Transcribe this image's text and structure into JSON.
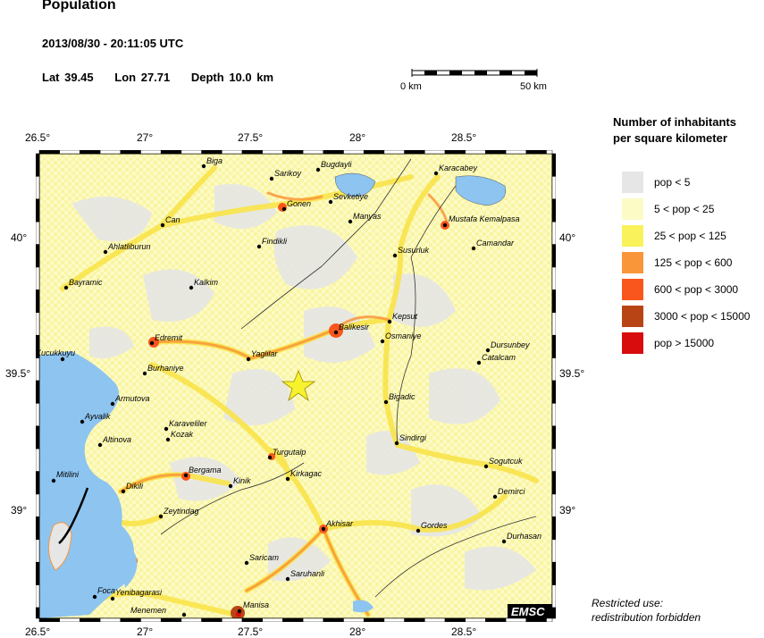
{
  "header": {
    "title": "Population",
    "datetime": "2013/08/30 - 20:11:05 UTC",
    "lat_label": "Lat 39.45",
    "lon_label": "Lon 27.71",
    "depth_label": "Depth 10.0 km"
  },
  "scale_bar": {
    "start_label": "0 km",
    "end_label": "50 km"
  },
  "axes": {
    "top_ticks": [
      "26.5°",
      "27°",
      "27.5°",
      "28°",
      "28.5°"
    ],
    "bottom_ticks": [
      "26.5°",
      "27°",
      "27.5°",
      "28°",
      "28.5°"
    ],
    "left_ticks": [
      "40°",
      "39.5°",
      "39°"
    ],
    "right_ticks": [
      "40°",
      "39.5°",
      "39°"
    ]
  },
  "legend": {
    "title_line1": "Number of inhabitants",
    "title_line2": "per square kilometer",
    "items": [
      {
        "label": "pop < 5",
        "color": "#e6e6e6"
      },
      {
        "label": "5 < pop < 25",
        "color": "#fcfbc6"
      },
      {
        "label": "25 < pop < 125",
        "color": "#f9f25a"
      },
      {
        "label": "125 < pop < 600",
        "color": "#f9963a"
      },
      {
        "label": "600 < pop < 3000",
        "color": "#f8561c"
      },
      {
        "label": "3000 < pop < 15000",
        "color": "#b84415"
      },
      {
        "label": "pop > 15000",
        "color": "#d80c0c"
      }
    ]
  },
  "map": {
    "epicenter": {
      "lat": 39.45,
      "lon": 27.71,
      "marker": "yellow-star"
    },
    "logo_text": "EMSC",
    "cities": [
      {
        "name": "Biga"
      },
      {
        "name": "Sarikoy"
      },
      {
        "name": "Bugdayli"
      },
      {
        "name": "Karacabey"
      },
      {
        "name": "Sevketiye"
      },
      {
        "name": "Gonen"
      },
      {
        "name": "Manyas"
      },
      {
        "name": "Can"
      },
      {
        "name": "Mustafa Kemalpasa"
      },
      {
        "name": "Ahlatliburun"
      },
      {
        "name": "Findikli"
      },
      {
        "name": "Camandar"
      },
      {
        "name": "Susurluk"
      },
      {
        "name": "Bayramic"
      },
      {
        "name": "Kalkim"
      },
      {
        "name": "Kepsut"
      },
      {
        "name": "Balikesir"
      },
      {
        "name": "Osmaniye"
      },
      {
        "name": "Dursunbey"
      },
      {
        "name": "Kucukkuyu"
      },
      {
        "name": "Edremit"
      },
      {
        "name": "Yaglilar"
      },
      {
        "name": "Catalcam"
      },
      {
        "name": "Burhaniye"
      },
      {
        "name": "Armutova"
      },
      {
        "name": "Bigadic"
      },
      {
        "name": "Ayvalik"
      },
      {
        "name": "Karaveliler"
      },
      {
        "name": "Kozak"
      },
      {
        "name": "Altinova"
      },
      {
        "name": "Turgutalp"
      },
      {
        "name": "Sindirgi"
      },
      {
        "name": "Bergama"
      },
      {
        "name": "Kirkagac"
      },
      {
        "name": "Mitilini"
      },
      {
        "name": "Dikili"
      },
      {
        "name": "Kinik"
      },
      {
        "name": "Sogutcuk"
      },
      {
        "name": "Demirci"
      },
      {
        "name": "Zeytindag"
      },
      {
        "name": "Akhisar"
      },
      {
        "name": "Gordes"
      },
      {
        "name": "Durhasan"
      },
      {
        "name": "Saricam"
      },
      {
        "name": "Saruhanli"
      },
      {
        "name": "Foca"
      },
      {
        "name": "Yenibagarasi"
      },
      {
        "name": "Menemen"
      },
      {
        "name": "Manisa"
      }
    ]
  },
  "footer": {
    "line1": "Restricted use:",
    "line2": "redistribution forbidden"
  }
}
